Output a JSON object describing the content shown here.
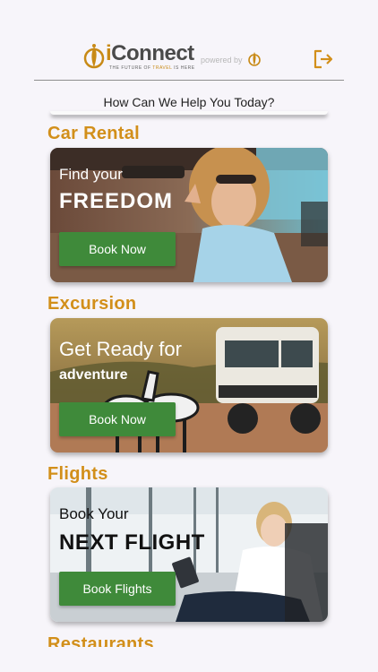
{
  "header": {
    "brand_i": "i",
    "brand_rest": "Connect",
    "tagline_pre": "THE FUTURE OF ",
    "tagline_travel": "TRAVEL",
    "tagline_post": " IS HERE",
    "powered_by": "powered by",
    "logout_icon": "logout-icon"
  },
  "help_prompt": "How Can We Help You Today?",
  "sections": [
    {
      "title": "Car Rental",
      "line1": "Find your",
      "line2": "FREEDOM",
      "button": "Book Now"
    },
    {
      "title": "Excursion",
      "line1": "Get Ready for",
      "line2": "adventure",
      "button": "Book Now"
    },
    {
      "title": "Flights",
      "line1": "Book Your",
      "line2": "NEXT FLIGHT",
      "button": "Book Flights"
    },
    {
      "title": "Restaurants"
    }
  ],
  "colors": {
    "accent": "#d28f1a",
    "button": "#3f8a3a",
    "background": "#f7f5fa"
  }
}
